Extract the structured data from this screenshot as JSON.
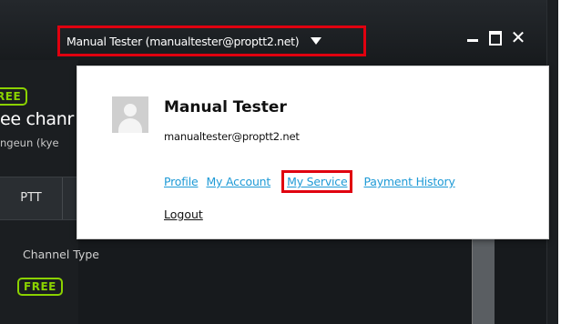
{
  "titlebar": {
    "account_label": "Manual Tester (manualtester@proptt2.net)",
    "controls": {
      "minimize_icon": "minimize-icon",
      "maximize_icon": "maximize-icon",
      "close_glyph": "✕"
    }
  },
  "background": {
    "badge_top": "REE",
    "channel_name": "ee chanr",
    "owner_partial": "ngeun (kye",
    "tab_ptt": "PTT",
    "channel_type_label": "Channel Type",
    "badge_bottom": "FREE"
  },
  "popup": {
    "name": "Manual Tester",
    "email": "manualtester@proptt2.net",
    "links": [
      "Profile",
      "My Account",
      "My Service",
      "Payment History"
    ],
    "highlighted_link": "My Service",
    "logout": "Logout"
  },
  "colors": {
    "highlight": "#e0000f",
    "link": "#1e9ad6",
    "free_badge": "#8bd200",
    "window_bg": "#171a1d"
  }
}
